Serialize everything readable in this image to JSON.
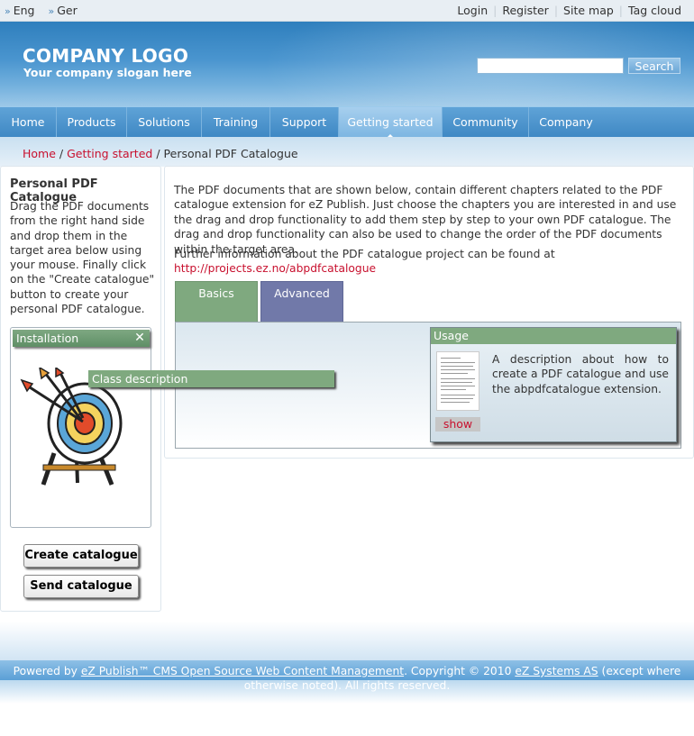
{
  "topbar": {
    "languages": [
      "Eng",
      "Ger"
    ],
    "links": [
      "Login",
      "Register",
      "Site map",
      "Tag cloud"
    ]
  },
  "header": {
    "logo": "COMPANY LOGO",
    "slogan": "Your company slogan here",
    "search": {
      "button_label": "Search",
      "value": ""
    }
  },
  "nav": {
    "tabs": [
      "Home",
      "Products",
      "Solutions",
      "Training",
      "Support",
      "Getting started",
      "Community",
      "Company"
    ],
    "active": "Getting started"
  },
  "breadcrumb": {
    "items": [
      "Home",
      "Getting started"
    ],
    "current": "Personal PDF Catalogue",
    "separator": "/"
  },
  "sidebar": {
    "title": "Personal PDF Catalogue",
    "intro": "Drag the PDF documents from the right hand side and drop them in the target area below using your mouse. Finally click on the \"Create catalogue\" button to create your personal PDF catalogue.",
    "dropzone": {
      "item_label": "Installation",
      "close_icon": "close-icon"
    },
    "buttons": {
      "create": "Create catalogue",
      "send": "Send catalogue"
    }
  },
  "main": {
    "paragraph1": "The PDF documents that are shown below, contain different chapters related to the PDF catalogue extension for eZ Publish. Just choose the chapters you are interested in and use the drag and drop functionality to add them step by step to your own PDF catalogue. The drag and drop functionality can also be used to change the order of the PDF documents within the target area.",
    "paragraph2_prefix": "Further information about the PDF catalogue project can be found at ",
    "paragraph2_url": "http://projects.ez.no/abpdfcatalogue",
    "tabs": {
      "basics": "Basics",
      "advanced": "Advanced"
    },
    "usage": {
      "title": "Usage",
      "description": "A description about how to create a PDF catalogue and use the abpdfcatalogue extension.",
      "show_label": "show"
    },
    "dragging_item": "Class description"
  },
  "footer": {
    "prefix": "Powered by ",
    "link1": "eZ Publish™ CMS Open Source Web Content Management",
    "middle": ". Copyright © 2010 ",
    "link2": "eZ Systems AS",
    "suffix": " (except where otherwise noted). All rights reserved."
  },
  "colors": {
    "accent_red": "#c8102e",
    "header_blue": "#3f88c4",
    "tab_green": "#7fa97f",
    "tab_purple": "#7179a9"
  }
}
